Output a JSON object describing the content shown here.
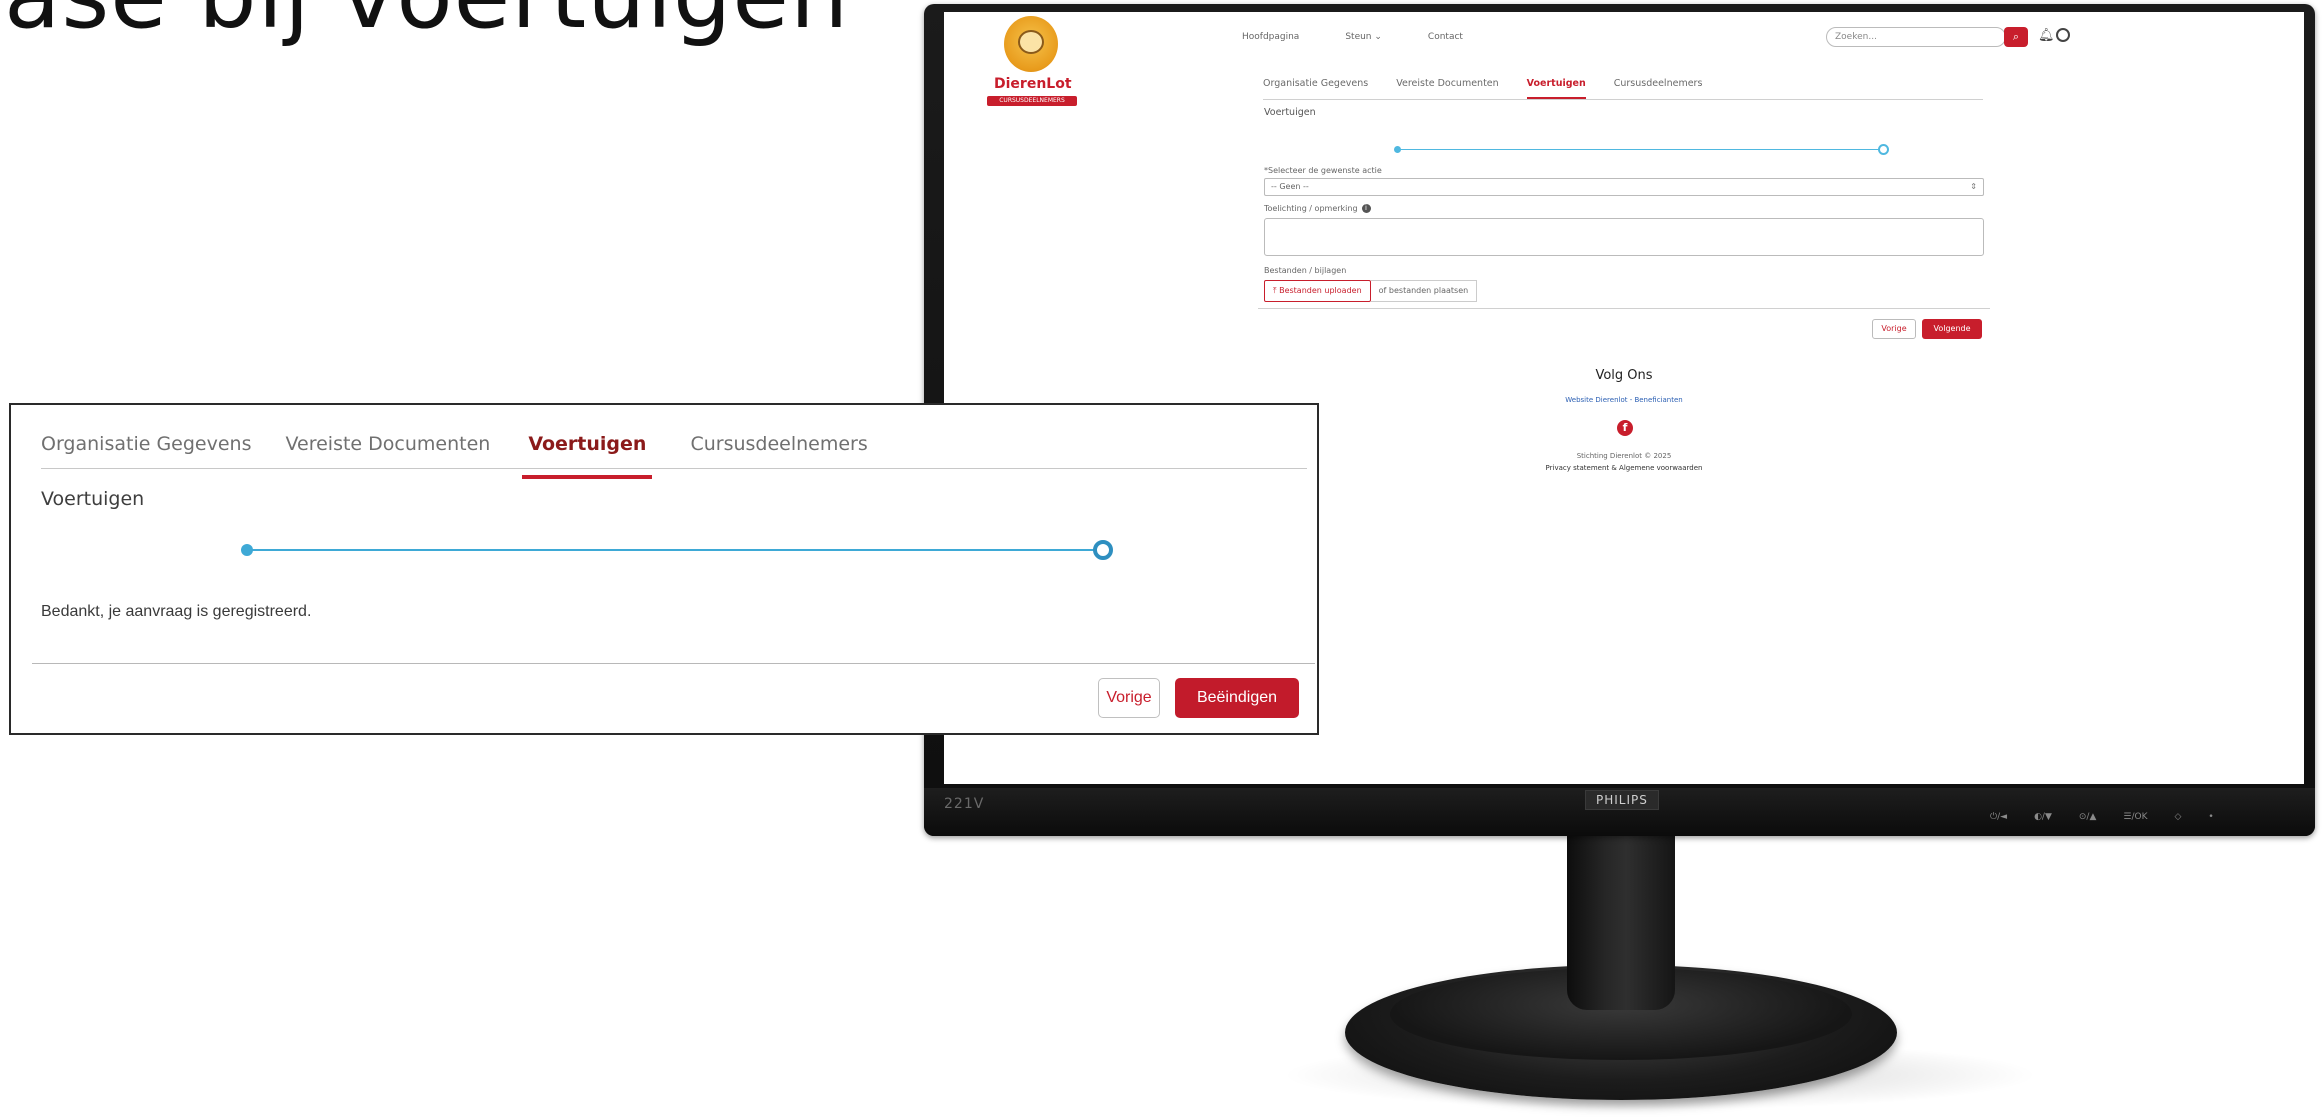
{
  "slide": {
    "title": "ase bij voertuigen"
  },
  "monitor": {
    "model": "221V",
    "brand": "PHILIPS",
    "controls": [
      "⏻/◄",
      "◐/▼",
      "⊙/▲",
      "☰/OK",
      "◇",
      "•"
    ]
  },
  "site": {
    "logo": {
      "word": "DierenLot",
      "bar": "CURSUSDEELNEMERS"
    },
    "nav": [
      "Hoofdpagina",
      "Steun ⌄",
      "Contact"
    ],
    "search": {
      "placeholder": "Zoeken...",
      "button_icon": "search-icon"
    },
    "tabs": [
      "Organisatie Gegevens",
      "Vereiste Documenten",
      "Voertuigen",
      "Cursusdeelnemers"
    ],
    "active_tab": "Voertuigen",
    "section_title": "Voertuigen",
    "form": {
      "select_label": "*Selecteer de gewenste actie",
      "select_value": "-- Geen --",
      "remark_label": "Toelichting / opmerking",
      "files_label": "Bestanden / bijlagen",
      "upload_label": "Bestanden uploaden",
      "drop_label": "of bestanden plaatsen"
    },
    "buttons": {
      "prev": "Vorige",
      "next": "Volgende"
    },
    "footer": {
      "title": "Volg Ons",
      "link": "Website Dierenlot - Beneficianten",
      "copyright": "Stichting Dierenlot © 2025",
      "privacy": "Privacy statement & Algemene voorwaarden"
    }
  },
  "callout": {
    "tabs": [
      "Organisatie Gegevens",
      "Vereiste Documenten",
      "Voertuigen",
      "Cursusdeelnemers"
    ],
    "active_tab": "Voertuigen",
    "section_title": "Voertuigen",
    "progress": {
      "steps": 2,
      "current": 2
    },
    "message": "Bedankt, je aanvraag is geregistreerd.",
    "buttons": {
      "prev": "Vorige",
      "finish": "Beëindigen"
    }
  },
  "colors": {
    "brand_red": "#c81e2c",
    "progress_blue": "#3ea9d6",
    "bezel": "#111111"
  }
}
